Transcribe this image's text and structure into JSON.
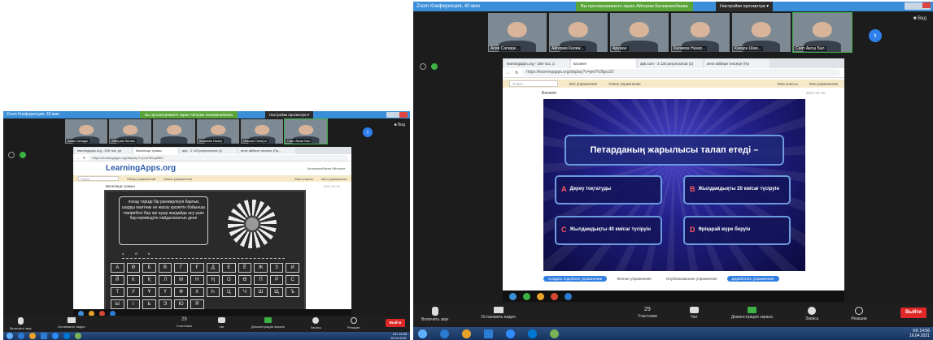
{
  "screens": [
    {
      "window_title": "Zoom Конференция, 40 мин",
      "share_banner": "Вы просматриваете экран Айгерим Калижанабаева",
      "view_options": "Настройки просмотра ▾",
      "gallery_label": "■ Вид",
      "participants": [
        "Асия Сапидж",
        "Айгерим Калиж",
        "",
        "Калиева Назер",
        "Ильназ Гизатул",
        "Саят Акош Бал"
      ],
      "browser": {
        "tabs": [
          "learningapps.org - 259 тыс. ре",
          "Виселица тузакы",
          "apk - 2 120 результатов (1)",
          "инти айбери тексере (Пр..."
        ],
        "url": "https://learningapps.org/display?v=pnn7fbcq0f6f3",
        "logo": "LearningApps.org",
        "user_line": "Калижанабаева Айгерим",
        "search_placeholder": "Поиск",
        "toolbar_links": [
          "Обзор упражнений",
          "Новое упражнение",
          "Мои классы",
          "Мои упражнения"
        ],
        "breadcrumb": "Виселица тузакы",
        "date": "2021-04-16",
        "question": "поезд тәрізді бір ранжирлеулі барлық шарды маятник не жасау қасиетін бойынша тәжірибесі бар әрі ауыр жағдайда асу үшін бар мүмкіндігін пайдаланатын дене",
        "letters_row": "А Ә Б",
        "keys": [
          "А",
          "Ә",
          "Б",
          "В",
          "Г",
          "Ғ",
          "Д",
          "Е",
          "Ё",
          "Ж",
          "З",
          "И",
          "Й",
          "К",
          "Қ",
          "Л",
          "М",
          "Н",
          "Ң",
          "О",
          "Ө",
          "П",
          "Р",
          "С",
          "Т",
          "У",
          "Ұ",
          "Ү",
          "Ф",
          "Х",
          "Һ",
          "Ц",
          "Ч",
          "Ш",
          "Щ",
          "Ъ",
          "Ы",
          "І",
          "Ь",
          "Э",
          "Ю",
          "Я"
        ]
      },
      "zoom_bar": {
        "items": [
          "Включить звук",
          "Остановить видео",
          "Участники",
          "Чат",
          "Демонстрация экрана",
          "Запись",
          "Реакции"
        ],
        "participants_count": "29",
        "leave": "Выйти"
      },
      "tray": {
        "lang": "RU",
        "time": "14:55",
        "date": "16.04.2021"
      }
    },
    {
      "window_title": "Zoom Конференция, 40 мин",
      "share_banner": "Вы просматриваете экран Айгерим Калижанабаева",
      "view_options": "Настройки просмотра ▾",
      "gallery_label": "■ Вид",
      "participants": [
        "Асия Сапидж...",
        "Айгерим Калиж...",
        "Аружан",
        "Калиева Назер...",
        "Кахарн Шам...",
        "Саят Акош Бал"
      ],
      "browser": {
        "tabs": [
          "learningapps.org - 259 тыс. р",
          "Бәсекет",
          "apk.com - 2 120 результатов (1)",
          "инти айбери тексере (Пр"
        ],
        "url": "https://learningapps.org/display?v=pm7h2fgsz22",
        "search_placeholder": "Поиск",
        "toolbar_links": [
          "Все упражнения",
          "Новое упражнение",
          "Мои классы",
          "Мои упражнения"
        ],
        "breadcrumb": "Бәсекет",
        "date": "2021-04-16",
        "question": "Петарданың жарылысы талап етеді –",
        "answers": [
          {
            "letter": "A",
            "text": "Дереу тоқтатуды"
          },
          {
            "letter": "B",
            "text": "Жылдамдықты 20 км/сағ түсіруін"
          },
          {
            "letter": "C",
            "text": "Жылдамдықты 40 км/сағ түсіруін"
          },
          {
            "letter": "D",
            "text": "Әріқарай жүре беруін"
          }
        ],
        "bottom_buttons": [
          "Создать подобное упражнение",
          "Личное упражнение",
          "Опубликованное упражнение",
          "Доработать упражнение"
        ]
      },
      "zoom_bar": {
        "items": [
          "Включить звук",
          "Остановить видео",
          "Участники",
          "Чат",
          "Демонстрация экрана",
          "Запись",
          "Реакции"
        ],
        "participants_count": "29",
        "leave": "Выйти"
      },
      "tray": {
        "lang": "KK",
        "time": "14:56",
        "date": "16.04.2021"
      }
    }
  ]
}
